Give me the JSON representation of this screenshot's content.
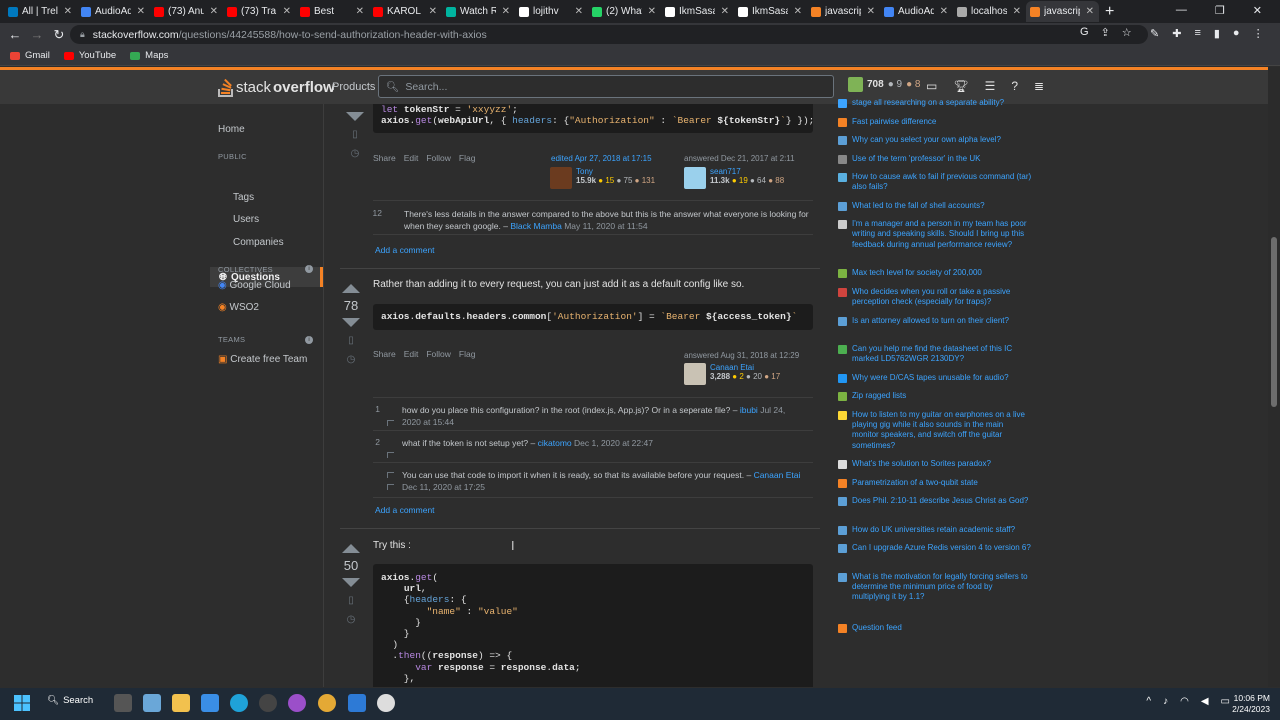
{
  "browser": {
    "tabs": [
      {
        "title": "All | Trello",
        "color": "#0079bf"
      },
      {
        "title": "AudioAd",
        "color": "#4285f4"
      },
      {
        "title": "(73) Anu",
        "color": "#ff0000"
      },
      {
        "title": "(73) Tra",
        "color": "#ff0000"
      },
      {
        "title": "Best",
        "color": "#ff0000"
      },
      {
        "title": "KAROL G",
        "color": "#ff0000"
      },
      {
        "title": "Watch R",
        "color": "#00b4a0"
      },
      {
        "title": "lojithv",
        "color": "#ffffff"
      },
      {
        "title": "(2) What",
        "color": "#25d366"
      },
      {
        "title": "IkmSasa",
        "color": "#ffffff"
      },
      {
        "title": "IkmSasa",
        "color": "#ffffff"
      },
      {
        "title": "javascrip",
        "color": "#f48225"
      },
      {
        "title": "AudioAd",
        "color": "#4285f4"
      },
      {
        "title": "localhost",
        "color": "#aaaaaa"
      },
      {
        "title": "javascrip",
        "color": "#f48225"
      }
    ],
    "url_host": "stackoverflow.com",
    "url_path": "/questions/44245588/how-to-send-authorization-header-with-axios",
    "bookmarks": [
      {
        "label": "Gmail",
        "color": "#ea4335"
      },
      {
        "label": "YouTube",
        "color": "#ff0000"
      },
      {
        "label": "Maps",
        "color": "#34a853"
      }
    ]
  },
  "so": {
    "logo_a": "stack",
    "logo_b": "overflow",
    "products": "Products",
    "search_placeholder": "Search...",
    "reputation": "708",
    "silver": "● 9",
    "bronze": "● 8"
  },
  "leftnav": {
    "home": "Home",
    "public": "PUBLIC",
    "questions": "Questions",
    "tags": "Tags",
    "users": "Users",
    "companies": "Companies",
    "collectives": "COLLECTIVES",
    "google_cloud": "Google Cloud",
    "wso2": "WSO2",
    "teams": "TEAMS",
    "create_team": "Create free Team"
  },
  "answer1": {
    "code_line1": "let tokenStr = 'xxyyzz';",
    "code_line2": "axios.get(webApiUrl, { headers: {\"Authorization\" : `Bearer ${tokenStr}`} });",
    "actions": [
      "Share",
      "Edit",
      "Follow",
      "Flag"
    ],
    "edited": "edited Apr 27, 2018 at 17:15",
    "editor": {
      "name": "Tony",
      "rep": "15.9k",
      "gold": "● 15",
      "silver": "● 75",
      "bronze": "● 131"
    },
    "answered": "answered Dec 21, 2017 at 2:11",
    "author": {
      "name": "sean717",
      "rep": "11.3k",
      "gold": "● 19",
      "silver": "● 64",
      "bronze": "● 88"
    },
    "comment": {
      "score": "12",
      "text": "There's less details in the answer compared to the above but this is the answer what everyone is looking for when they search google. –",
      "user": "Black Mamba",
      "date": "May 11, 2020 at 11:54"
    },
    "add_comment": "Add a comment"
  },
  "answer2": {
    "votes": "78",
    "text": "Rather than adding it to every request, you can just add it as a default config like so.",
    "code": "axios.defaults.headers.common['Authorization'] = `Bearer ${access_token}`",
    "actions": [
      "Share",
      "Edit",
      "Follow",
      "Flag"
    ],
    "answered": "answered Aug 31, 2018 at 12:29",
    "author": {
      "name": "Canaan Etai",
      "rep": "3,288",
      "gold": "● 2",
      "silver": "● 20",
      "bronze": "● 17"
    },
    "comments": [
      {
        "score": "1",
        "text": "how do you place this configuration? in the root (index.js, App.js)? Or in a seperate file? –",
        "user": "ibubi",
        "date": "Jul 24, 2020 at 15:44"
      },
      {
        "score": "2",
        "text": "what if the token is not setup yet? –",
        "user": "cikatomo",
        "date": "Dec 1, 2020 at 22:47"
      },
      {
        "score": "",
        "text": "You can use that code to import it when it is ready, so that its available before your request. –",
        "user": "Canaan Etai",
        "date": "Dec 11, 2020 at 17:25"
      }
    ],
    "add_comment": "Add a comment"
  },
  "answer3": {
    "votes": "50",
    "text": "Try this :"
  },
  "hot_questions": [
    {
      "text": "stage all researching on a separate ability?",
      "color": "#3ca4ff"
    },
    {
      "text": "Fast pairwise difference",
      "color": "#f48225"
    },
    {
      "text": "Why can you select your own alpha level?",
      "color": "#5c9fd6"
    },
    {
      "text": "Use of the term 'professor' in the UK",
      "color": "#888888"
    },
    {
      "text": "How to cause awk to fail if previous command (tar) also fails?",
      "color": "#5ab0e0"
    },
    {
      "text": "What led to the fall of shell accounts?",
      "color": "#5c9fd6"
    },
    {
      "text": "I'm a manager and a person in my team has poor writing and speaking skills. Should I bring up this feedback during annual performance review?",
      "color": "#cccccc"
    },
    {
      "text": "Max tech level for society of 200,000",
      "color": "#7cb342"
    },
    {
      "text": "Who decides when you roll or take a passive perception check (especially for traps)?",
      "color": "#d0443e"
    },
    {
      "text": "Is an attorney allowed to turn on their client?",
      "color": "#5c9fd6"
    },
    {
      "text": "Can you help me find the datasheet of this IC marked LD5762WGR 2130DY?",
      "color": "#4caf50"
    },
    {
      "text": "Why were D/CAS tapes unusable for audio?",
      "color": "#2196f3"
    },
    {
      "text": "Zip ragged lists",
      "color": "#7cb342"
    },
    {
      "text": "How to listen to my guitar on earphones on a live playing gig while it also sounds in the main monitor speakers, and switch off the guitar sometimes?",
      "color": "#fdd835"
    },
    {
      "text": "What's the solution to Sorites paradox?",
      "color": "#dddddd"
    },
    {
      "text": "Parametrization of a two-qubit state",
      "color": "#f48225"
    },
    {
      "text": "Does Phil. 2:10-11 describe Jesus Christ as God?",
      "color": "#5c9fd6"
    },
    {
      "text": "How do UK universities retain academic staff?",
      "color": "#5c9fd6"
    },
    {
      "text": "Can I upgrade Azure Redis version 4 to version 6?",
      "color": "#5c9fd6"
    },
    {
      "text": "What is the motivation for legally forcing sellers to determine the minimum price of food by multiplying it by 1.1?",
      "color": "#5c9fd6"
    }
  ],
  "question_feed": "Question feed",
  "taskbar": {
    "search": "Search",
    "time": "10:06 PM",
    "date": "2/24/2023"
  }
}
